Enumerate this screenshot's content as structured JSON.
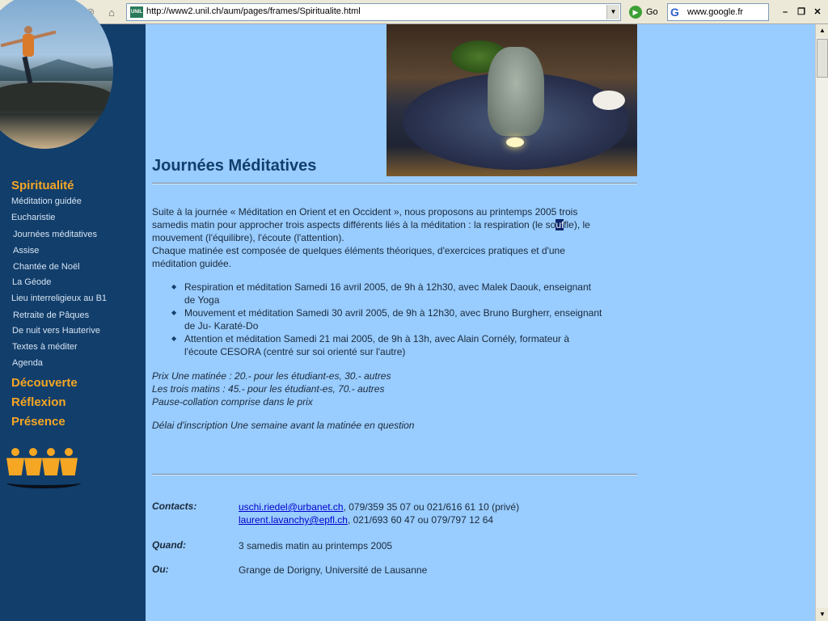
{
  "browser": {
    "url": "http://www2.unil.ch/aum/pages/frames/Spiritualite.html",
    "favicon_label": "UNIL",
    "go_label": "Go",
    "search_value": "www.google.fr",
    "icons": [
      "back-icon",
      "forward-icon",
      "refresh-icon",
      "stop-icon",
      "home-icon",
      "go-icon",
      "google-icon",
      "minimize-icon",
      "restore-icon",
      "close-icon"
    ]
  },
  "sidebar": {
    "sections": [
      {
        "label": "Spiritualité"
      },
      {
        "label": "Découverte"
      },
      {
        "label": "Réflexion"
      },
      {
        "label": "Présence"
      }
    ],
    "items": [
      {
        "label": "Méditation guidée"
      },
      {
        "label": "Eucharistie"
      },
      {
        "label": "Journées méditatives"
      },
      {
        "label": "Assise"
      },
      {
        "label": "Chantée de Noël"
      },
      {
        "label": "La Géode"
      },
      {
        "label": "Lieu interreligieux au B1"
      },
      {
        "label": "Retraite de Pâques"
      },
      {
        "label": "De nuit vers Hauterive"
      },
      {
        "label": "Textes à méditer"
      },
      {
        "label": "Agenda"
      }
    ]
  },
  "main": {
    "title": "Journées Méditatives",
    "intro_line1": "Suite à la journée « Méditation en Orient et en Occident », nous proposons au printemps 2005 trois",
    "intro_line2_a": "samedis matin pour approcher trois aspects différents liés à la méditation : la respiration (le so",
    "intro_line2_hl": "uf",
    "intro_line2_b": "fle), le",
    "intro_line3": "mouvement (l'équilibre), l'écoute (l'attention).",
    "intro_line4": "Chaque matinée est composée de quelques éléments théoriques, d'exercices pratiques et d'une",
    "intro_line5": "méditation guidée.",
    "sessions": [
      {
        "line1": "Respiration et méditation Samedi 16 avril 2005, de 9h à 12h30, avec Malek Daouk, enseignant",
        "line2": "de Yoga"
      },
      {
        "line1": "Mouvement et méditation Samedi 30 avril 2005, de 9h à 12h30, avec Bruno Burgherr, enseignant",
        "line2": "de Ju- Karaté-Do"
      },
      {
        "line1": "Attention et méditation Samedi 21 mai 2005, de 9h à 13h, avec Alain Cornély, formateur à",
        "line2": "l'écoute CESORA (centré sur soi orienté sur l'autre)"
      }
    ],
    "price_line1": "Prix Une matinée : 20.- pour les étudiant-es, 30.- autres",
    "price_line2": "Les trois matins : 45.- pour les étudiant-es, 70.- autres",
    "price_line3": "Pause-collation comprise dans le prix",
    "deadline": "Délai d'inscription Une semaine avant la matinée en question",
    "contacts_label": "Contacts:",
    "contact1_email": "uschi.riedel@urbanet.ch",
    "contact1_phone": ", 079/359 35 07 ou 021/616 61 10 (privé)",
    "contact2_email": "laurent.lavanchy@epfl.ch",
    "contact2_phone": ", 021/693 60 47 ou 079/797 12 64",
    "when_label": "Quand:",
    "when_value": "3 samedis matin au printemps 2005",
    "where_label": "Ou:",
    "where_value": "Grange de Dorigny, Université de Lausanne"
  }
}
